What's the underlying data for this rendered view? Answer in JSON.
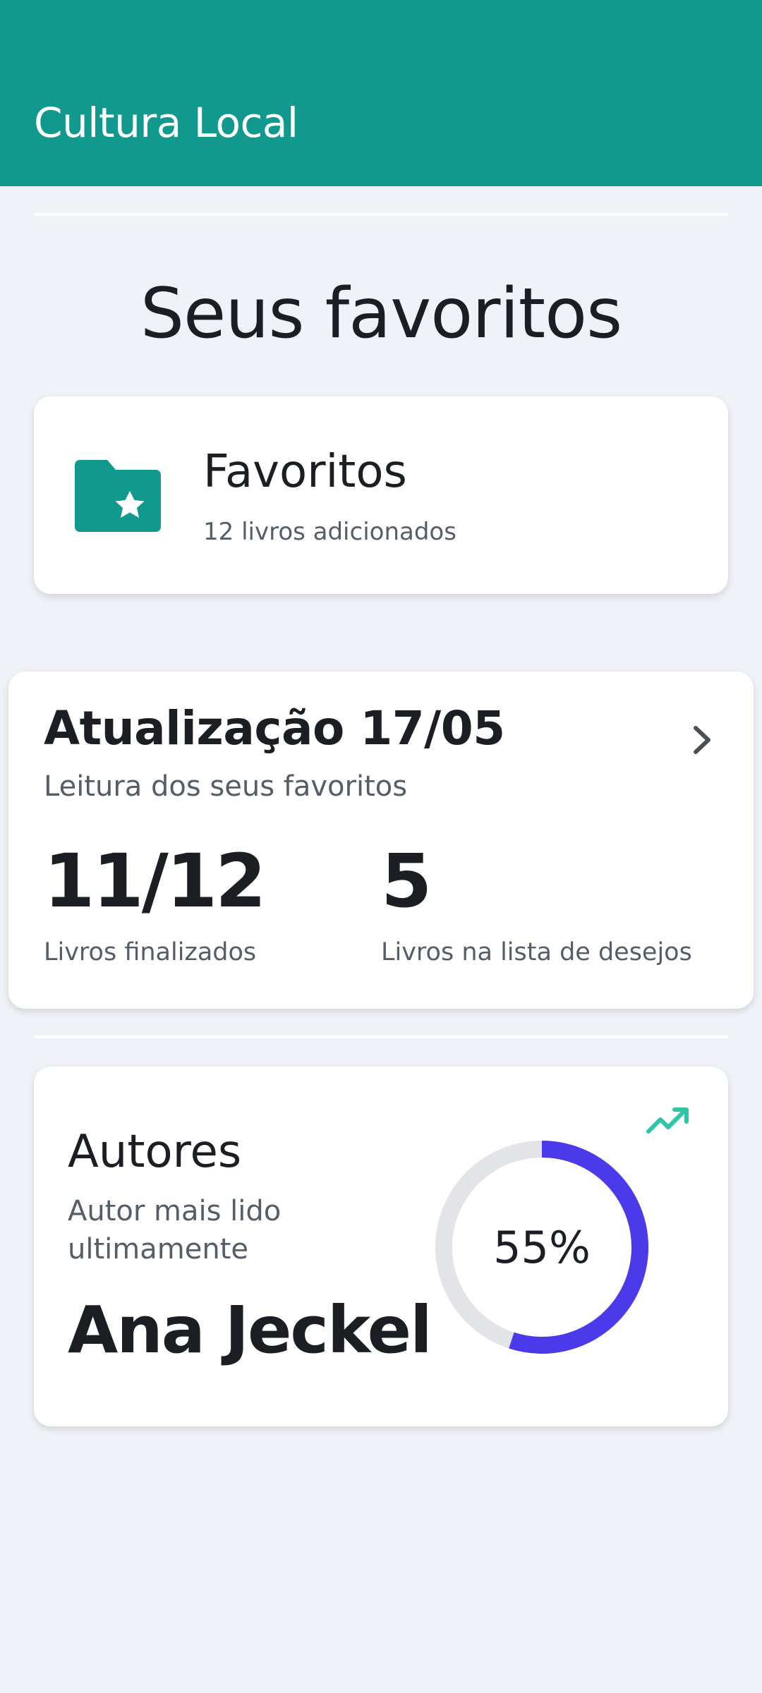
{
  "app": {
    "title": "Cultura Local",
    "accent": "#11998e"
  },
  "page": {
    "heading": "Seus favoritos"
  },
  "favorites": {
    "icon": "folder-star-icon",
    "title": "Favoritos",
    "subtitle": "12 livros adicionados"
  },
  "update": {
    "title": "Atualização 17/05",
    "subtitle": "Leitura dos seus favoritos",
    "chevron_icon": "chevron-right-icon",
    "stats": [
      {
        "value": "11/12",
        "label": "Livros finalizados"
      },
      {
        "value": "5",
        "label": "Livros na lista de desejos"
      }
    ]
  },
  "authors": {
    "title": "Autores",
    "subtitle": "Autor mais lido ultimamente",
    "name": "Ana Jeckel",
    "trend_icon": "trending-up-icon",
    "progress": 0.55,
    "progress_label": "55%",
    "progress_color": "#4a3aea",
    "track_color": "#e2e4e8"
  }
}
